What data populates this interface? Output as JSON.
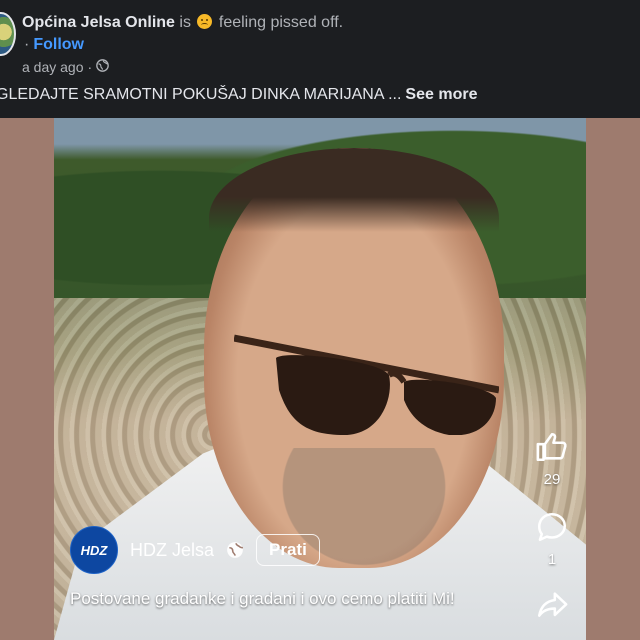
{
  "post": {
    "page_name": "Općina Jelsa Online",
    "activity_prefix": "is",
    "activity_text": "feeling pissed off.",
    "follow_separator": "·",
    "follow_label": "Follow",
    "time": "a day ago",
    "meta_separator": "·",
    "caption": "GLEDAJTE SRAMOTNI POKUŠAJ DINKA MARIJANA ...",
    "see_more": "See more"
  },
  "reel": {
    "page_name": "HDZ Jelsa",
    "logo_text": "HDZ",
    "follow_label": "Prati",
    "caption": "Postovane gradanke i gradani i ovo cemo platiti Mi!",
    "like_count": "29",
    "comment_count": "1"
  },
  "colors": {
    "background": "#1c1e21",
    "video_backdrop": "#9e7b6e",
    "follow_link": "#4599ff",
    "text_primary": "#e4e6eb",
    "text_secondary": "#b0b3b8"
  }
}
